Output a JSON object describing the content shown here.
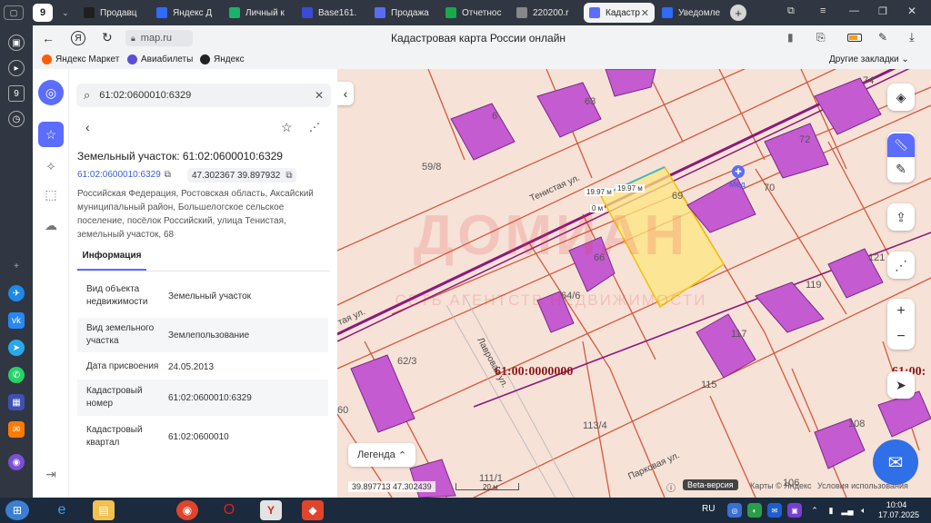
{
  "tabs": [
    {
      "label": "Продавц",
      "color": "#1f1f1f"
    },
    {
      "label": "Яндекс Д",
      "color": "#2f6bff"
    },
    {
      "label": "Личный к",
      "color": "#19b36b"
    },
    {
      "label": "Base161.",
      "color": "#3a4bd8"
    },
    {
      "label": "Продажа",
      "color": "#5b6cf0"
    },
    {
      "label": "Отчетнос",
      "color": "#1aa84b"
    },
    {
      "label": "220200.r",
      "color": "#888888"
    },
    {
      "label": "Кадастр",
      "color": "#5c6cff",
      "active": true
    },
    {
      "label": "Уведомле",
      "color": "#2f6bff"
    }
  ],
  "tab_counter": "9",
  "address": {
    "url": "map.ru",
    "title": "Кадастровая карта России онлайн"
  },
  "bookmarks": [
    {
      "label": "Яндекс Маркет"
    },
    {
      "label": "Авиабилеты"
    },
    {
      "label": "Яндекс"
    }
  ],
  "bookmarks_other": "Другие закладки",
  "panel": {
    "search_value": "61:02:0600010:6329",
    "title": "Земельный участок: 61:02:0600010:6329",
    "cad_link": "61:02:0600010:6329",
    "coords": "47.302367 39.897932",
    "address": "Российская Федерация, Ростовская область, Аксайский муниципальный район, Большелогское сельское поселение, посёлок Российский, улица Тенистая, земельный участок, 68",
    "tab_info": "Информация",
    "rows": [
      {
        "k": "Вид объекта недвижимости",
        "v": "Земельный участок"
      },
      {
        "k": "Вид земельного участка",
        "v": "Землепользование"
      },
      {
        "k": "Дата присвоения",
        "v": "24.05.2013"
      },
      {
        "k": "Кадастровый номер",
        "v": "61:02:0600010:6329"
      },
      {
        "k": "Кадастровый квартал",
        "v": "61:02:0600010"
      }
    ]
  },
  "map": {
    "labels": {
      "street1": "Тенистая ул.",
      "street2": "Лавровая ул.",
      "street3": "Парковая ул.",
      "street4": "тая ул.",
      "big_code": "61:00:0000000",
      "big_code2": "61:00:",
      "n59": "59/8",
      "n63": "63",
      "n6": "6",
      "n72": "72",
      "n74": "74",
      "n70": "70",
      "n69": "69",
      "n66": "66",
      "n64": "64/6",
      "n62": "62/3",
      "n60": "60",
      "n119": "119",
      "n121": "121",
      "n117": "117",
      "n115": "115",
      "n113": "113/4",
      "n111": "111/1",
      "n108": "108",
      "n106": "106",
      "med": "Мед",
      "m1": "19.97 м",
      "m2": "19.97 м",
      "m0": "0 м"
    },
    "legend": "Легенда",
    "coords_bottom": "39.897713   47.302439",
    "scale": "20 м",
    "beta": "Beta-версия",
    "copyright": "Карты © Яндекс",
    "terms": "Условия использования",
    "watermark": "ДОМИАН",
    "watermark_sub": "СЕТЬ АГЕНТСТВ НЕДВИЖИМОСТИ"
  },
  "taskbar": {
    "lang": "RU",
    "time": "10:04",
    "date": "17.07.2025"
  },
  "colors": {
    "parcel": "#d45a3c",
    "building": "#c55bd0",
    "selected": "#ffe680",
    "road": "#8b1a7a"
  }
}
